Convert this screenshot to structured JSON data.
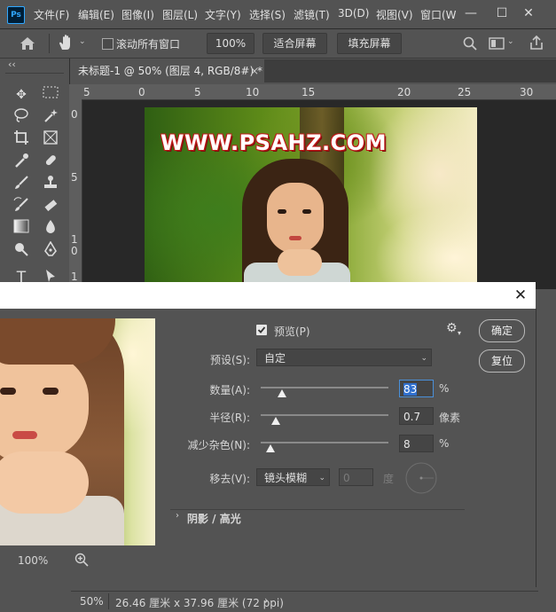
{
  "app": {
    "logo": "Ps"
  },
  "menu": [
    "文件(F)",
    "编辑(E)",
    "图像(I)",
    "图层(L)",
    "文字(Y)",
    "选择(S)",
    "滤镜(T)",
    "3D(D)",
    "视图(V)",
    "窗口(W"
  ],
  "window_controls": {
    "minimize": "—",
    "restore": "☐",
    "close": "✕"
  },
  "options": {
    "scroll_all_label": "滚动所有窗口",
    "zoom_value": "100%",
    "fit_screen": "适合屏幕",
    "fill_screen": "填充屏幕"
  },
  "tab": {
    "title": "未标题-1 @ 50% (图层 4, RGB/8#) *",
    "close": "×"
  },
  "panel_collapse": "‹‹",
  "ruler_h_ticks": [
    "5",
    "0",
    "5",
    "10",
    "15",
    "20",
    "25",
    "30"
  ],
  "ruler_v_ticks": [
    "0",
    "5",
    "1",
    "0",
    "1"
  ],
  "canvas": {
    "watermark": "WWW.PSAHZ.COM"
  },
  "dialog": {
    "close": "✕",
    "preview_label": "预览(P)",
    "preview_checked": true,
    "ok_button": "确定",
    "reset_button": "复位",
    "preset_label": "预设(S):",
    "preset_value": "自定",
    "amount_label": "数量(A):",
    "amount_value": "83",
    "amount_unit": "%",
    "amount_level": 0.83,
    "radius_label": "半径(R):",
    "radius_value": "0.7",
    "radius_unit": "像素",
    "noise_label": "减少杂色(N):",
    "noise_value": "8",
    "noise_unit": "%",
    "remove_label": "移去(V):",
    "remove_value": "镜头模糊",
    "angle_value": "0",
    "angle_unit": "度",
    "shadow_section": "阴影 / 高光",
    "zoom_value": "100%"
  },
  "status": {
    "zoom": "50%",
    "doc_size": "26.46 厘米 x 37.96 厘米 (72 ppi)"
  }
}
